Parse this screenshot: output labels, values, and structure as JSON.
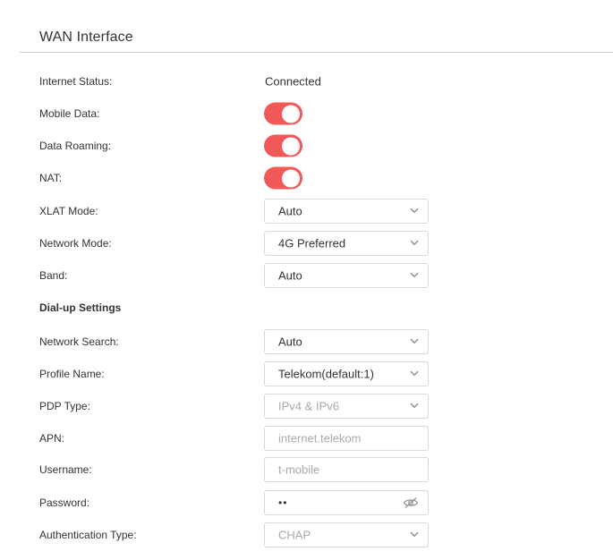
{
  "section": {
    "title": "WAN Interface"
  },
  "wan": {
    "internet_status": {
      "label": "Internet Status:",
      "value": "Connected"
    },
    "mobile_data": {
      "label": "Mobile Data:",
      "enabled": true
    },
    "data_roaming": {
      "label": "Data Roaming:",
      "enabled": true
    },
    "nat": {
      "label": "NAT:",
      "enabled": true
    },
    "xlat_mode": {
      "label": "XLAT Mode:",
      "value": "Auto"
    },
    "network_mode": {
      "label": "Network Mode:",
      "value": "4G Preferred"
    },
    "band": {
      "label": "Band:",
      "value": "Auto"
    }
  },
  "dialup": {
    "heading": "Dial-up Settings",
    "network_search": {
      "label": "Network Search:",
      "value": "Auto"
    },
    "profile_name": {
      "label": "Profile Name:",
      "value": "Telekom(default:1)"
    },
    "pdp_type": {
      "label": "PDP Type:",
      "value": "IPv4 & IPv6"
    },
    "apn": {
      "label": "APN:",
      "value": "internet.telekom"
    },
    "username": {
      "label": "Username:",
      "value": "t-mobile"
    },
    "password": {
      "label": "Password:",
      "value": "••"
    },
    "auth_type": {
      "label": "Authentication Type:",
      "value": "CHAP"
    }
  },
  "icons": {
    "dropdown": "chevron-down-icon",
    "password_visibility": "eye-slash-icon"
  },
  "colors": {
    "toggle_on": "#f0585a",
    "text": "#333333",
    "disabled_text": "#a9a9a9",
    "border": "#d9d9d9"
  }
}
